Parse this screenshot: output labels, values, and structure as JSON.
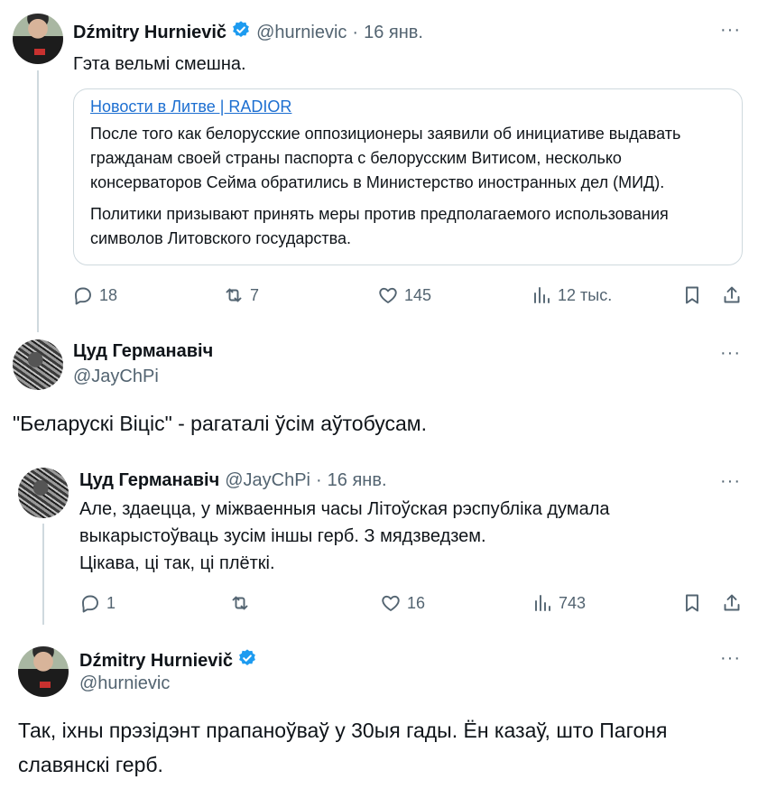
{
  "tweet1": {
    "name": "Dźmitry Hurnievič",
    "handle": "@hurnievic",
    "date": "16 янв.",
    "text": "Гэта вельмі смешна.",
    "quote": {
      "link": "Новости в Литве | RADIOR",
      "line1": "После того как белорусские оппозиционеры заявили об инициативе выдавать",
      "line2": "гражданам своей страны паспорта с белорусским Витисом, несколько",
      "line3": "консерваторов Сейма обратились в Министерство иностранных дел (МИД).",
      "line4": "Политики призывают принять меры против предполагаемого использования",
      "line5": "символов Литовского государства."
    },
    "actions": {
      "replies": "18",
      "reposts": "7",
      "likes": "145",
      "views": "12 тыс."
    }
  },
  "tweet2": {
    "name": "Цуд Германавіч",
    "handle": "@JayChPi",
    "text": "\"Беларускі Віціс\" - рагаталі ўсім аўтобусам."
  },
  "tweet3": {
    "name": "Цуд Германавіч",
    "handle": "@JayChPi",
    "date": "16 янв.",
    "line1": "Але, здаецца, у міжваенныя часы Літоўская рэспубліка думала",
    "line2": "выкарыстоўваць зусім іншы герб. З мядзведзем.",
    "line3": "Цікава, ці так, ці плёткі.",
    "actions": {
      "replies": "1",
      "reposts": "",
      "likes": "16",
      "views": "743"
    }
  },
  "tweet4": {
    "name": "Dźmitry Hurnievič",
    "handle": "@hurnievic",
    "line1": "Так, іхны прэзідэнт прапаноўваў у 30ыя гады. Ён казаў, што Пагоня",
    "line2": "славянскі герб."
  },
  "ui": {
    "more": "···",
    "dot": "·"
  },
  "colors": {
    "verified": "#1d9bf0",
    "link": "#1d6fd1",
    "secondary_text": "#536471",
    "border": "#cfd9de"
  },
  "icons": [
    "reply-icon",
    "repost-icon",
    "like-icon",
    "views-icon",
    "bookmark-icon",
    "share-icon",
    "verified-badge-icon",
    "more-icon"
  ]
}
